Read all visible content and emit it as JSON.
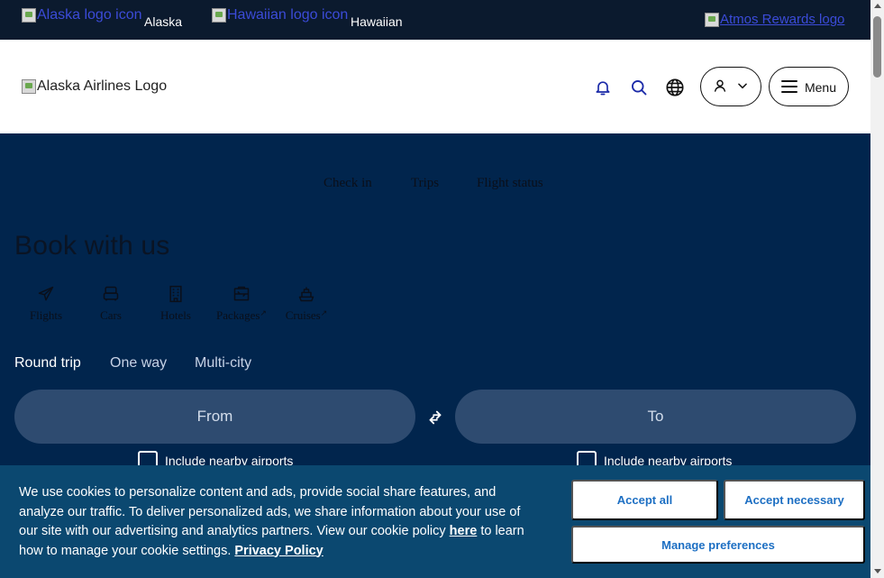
{
  "brandbar": {
    "alaska_logo_alt": "Alaska logo icon",
    "alaska_label": "Alaska",
    "hawaiian_logo_alt": "Hawaiian logo icon",
    "hawaiian_label": "Hawaiian",
    "atmos_logo_alt": "Atmos Rewards logo"
  },
  "header": {
    "logo_alt": "Alaska Airlines Logo",
    "menu_label": "Menu",
    "icons": [
      "bell-icon",
      "search-icon",
      "globe-icon",
      "user-icon",
      "chevron-down-icon",
      "hamburger-icon"
    ]
  },
  "quick_links": {
    "check_in": "Check in",
    "trips": "Trips",
    "flight_status": "Flight status"
  },
  "booking": {
    "title": "Book with us",
    "products": [
      {
        "label": "Flights",
        "icon": "plane-icon",
        "external": false
      },
      {
        "label": "Cars",
        "icon": "car-icon",
        "external": false
      },
      {
        "label": "Hotels",
        "icon": "hotel-icon",
        "external": false
      },
      {
        "label": "Packages",
        "icon": "package-icon",
        "external": true
      },
      {
        "label": "Cruises",
        "icon": "cruise-icon",
        "external": true
      }
    ],
    "trip_types": [
      "Round trip",
      "One way",
      "Multi-city"
    ],
    "selected_trip_type": "Round trip",
    "from_placeholder": "From",
    "to_placeholder": "To",
    "nearby_label": "Include nearby airports"
  },
  "cookie": {
    "text_before": "We use cookies to personalize content and ads, provide social share features, and analyze our traffic. To deliver personalized ads, we share information about your use of our site with our advertising and analytics partners. View our cookie policy ",
    "here_link": "here",
    "text_middle": " to learn how to manage your cookie settings. ",
    "privacy_link": "Privacy Policy",
    "accept_all": "Accept all",
    "accept_necessary": "Accept necessary",
    "manage_preferences": "Manage preferences"
  },
  "colors": {
    "brandbar_bg": "#0b1a2e",
    "hero_bg": "#01254d",
    "airport_field_bg": "#2e4b70",
    "cookie_bg": "#0b4870",
    "button_text": "#1d6fc3",
    "header_icon": "#1b2aa8"
  }
}
